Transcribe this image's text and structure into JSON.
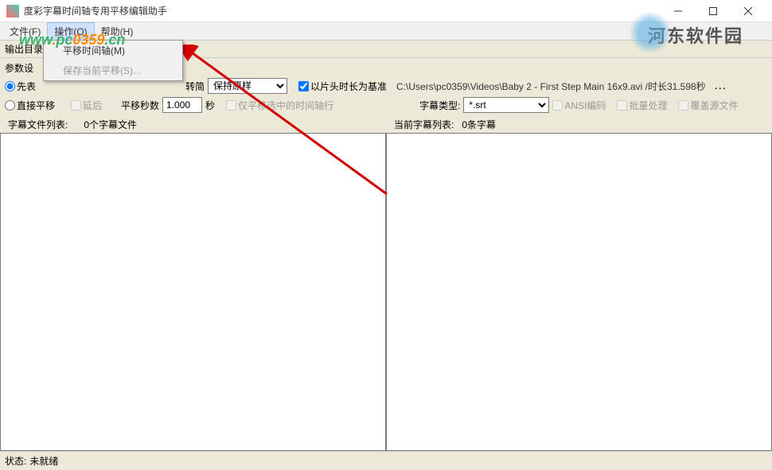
{
  "titlebar": {
    "title": "度彩字幕时间轴专用平移编辑助手"
  },
  "menubar": {
    "file": "文件(F)",
    "operate": "操作(O)",
    "help": "帮助(H)"
  },
  "dropdown": {
    "shift_timeline": "平移时间轴(M)",
    "save_current": "保存当前平移(S)…"
  },
  "section_output": "输出目录",
  "section_params": "参数设",
  "params": {
    "radio_first": "先表",
    "radio_direct": "直接平移",
    "checkbox_delay": "延后",
    "label_shift_seconds": "平移秒数",
    "value_shift_seconds": "1.000",
    "label_seconds": "秒",
    "checkbox_only_selected": "仅平移选中的时间轴行",
    "label_convert": "转简",
    "combo_keep": "保持原样",
    "checkbox_use_head": "以片头时长为基准",
    "file_path": "C:\\Users\\pc0359\\Videos\\Baby 2 - First Step Main 16x9.avi /时长31.598秒",
    "label_subtitle_type": "字幕类型:",
    "subtitle_type_value": "*.srt",
    "checkbox_ansi": "ANSI编码",
    "checkbox_batch": "批量处理",
    "checkbox_overwrite": "覆盖源文件"
  },
  "lists": {
    "left_label": "字幕文件列表:",
    "left_count": "0个字幕文件",
    "right_label": "当前字幕列表:",
    "right_count": "0条字幕"
  },
  "statusbar": {
    "label": "状态:",
    "value": "未就绪"
  },
  "watermark_text": "www.pc0359.cn",
  "watermark2_text": "河东软件园"
}
